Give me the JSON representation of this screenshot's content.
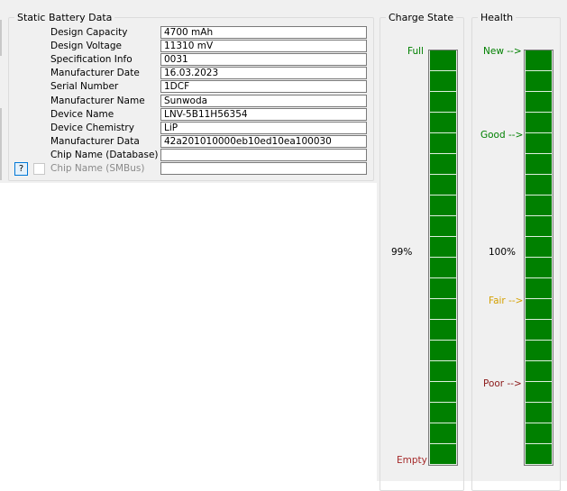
{
  "static_battery": {
    "title": "Static Battery Data",
    "rows": [
      {
        "label": "Design Capacity",
        "value": "4700 mAh"
      },
      {
        "label": "Design Voltage",
        "value": "11310 mV"
      },
      {
        "label": "Specification Info",
        "value": "0031"
      },
      {
        "label": "Manufacturer Date",
        "value": "16.03.2023"
      },
      {
        "label": "Serial Number",
        "value": "1DCF"
      },
      {
        "label": "Manufacturer Name",
        "value": "Sunwoda"
      },
      {
        "label": "Device Name",
        "value": "LNV-5B11H56354"
      },
      {
        "label": "Device Chemistry",
        "value": "LiP"
      },
      {
        "label": "Manufacturer Data",
        "value": "42a201010000eb10ed10ea100030"
      },
      {
        "label": "Chip Name (Database)",
        "value": ""
      },
      {
        "label": "Chip Name (SMBus)",
        "value": ""
      }
    ],
    "help_button": "?",
    "smbus_checkbox_checked": false
  },
  "charge_state": {
    "title": "Charge State",
    "top_label": "Full",
    "bottom_label": "Empty",
    "value_label": "99%",
    "level": 0.99,
    "fill_color": "#008000"
  },
  "health": {
    "title": "Health",
    "new_label": "New -->",
    "good_label": "Good -->",
    "value_label": "100%",
    "fair_label": "Fair -->",
    "poor_label": "Poor -->",
    "level": 1.0,
    "fill_color": "#008000"
  }
}
